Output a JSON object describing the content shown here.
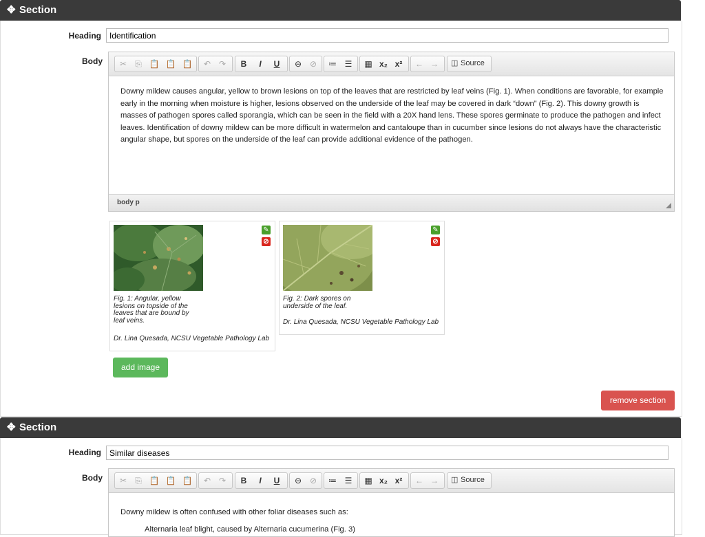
{
  "sections": [
    {
      "bar_title": "Section",
      "heading_label": "Heading",
      "heading_value": "Identification",
      "body_label": "Body",
      "toolbar": {
        "cut": "✂",
        "copy": "⎘",
        "paste": "📋",
        "paste_text": "📋",
        "paste_word": "📋",
        "undo": "↶",
        "redo": "↷",
        "bold": "B",
        "italic": "I",
        "underline": "U",
        "link": "⊖",
        "unlink": "⊘",
        "numbered_list": "≔",
        "bulleted_list": "☰",
        "table": "▦",
        "subscript": "x₂",
        "superscript": "x²",
        "back": "←",
        "forward": "→",
        "source_icon": "◫",
        "source_label": "Source"
      },
      "body_text": "Downy mildew causes angular, yellow to brown lesions on top of the leaves that are restricted by leaf veins (Fig. 1).  When conditions are favorable, for example early in the morning when moisture is higher, lesions observed on the underside of the leaf may be covered in dark “down” (Fig. 2).  This downy growth is masses of pathogen spores called sporangia, which can be seen in the field with a 20X hand lens. These spores germinate to produce the pathogen and infect leaves.  Identification of downy mildew can be more difficult in watermelon and cantaloupe than in cucumber since lesions do not always have the characteristic angular shape, but spores on the underside of the leaf can provide additional evidence of the pathogen.",
      "status_path": "body  p",
      "images": [
        {
          "caption": "Fig. 1: Angular, yellow lesions on topside of the leaves that are bound by leaf veins.",
          "credit": "Dr. Lina Quesada, NCSU Vegetable Pathology Lab",
          "edit_icon": "pencil-icon",
          "delete_icon": "ban-icon"
        },
        {
          "caption": "Fig. 2: Dark spores on underside of the leaf.",
          "credit": "Dr. Lina Quesada, NCSU Vegetable Pathology Lab",
          "edit_icon": "pencil-icon",
          "delete_icon": "ban-icon"
        }
      ],
      "add_image_label": "add image",
      "remove_section_label": "remove section"
    },
    {
      "bar_title": "Section",
      "heading_label": "Heading",
      "heading_value": "Similar diseases",
      "body_label": "Body",
      "body_text": "Downy mildew is often confused with other foliar diseases such as:",
      "list_item_1": "Alternaria leaf blight, caused by Alternaria cucumerina (Fig. 3)"
    }
  ],
  "colors": {
    "bar": "#3a3a3a",
    "add": "#5cb85c",
    "remove": "#d9534f",
    "edit": "#4aa02c",
    "delete": "#d9271e"
  }
}
